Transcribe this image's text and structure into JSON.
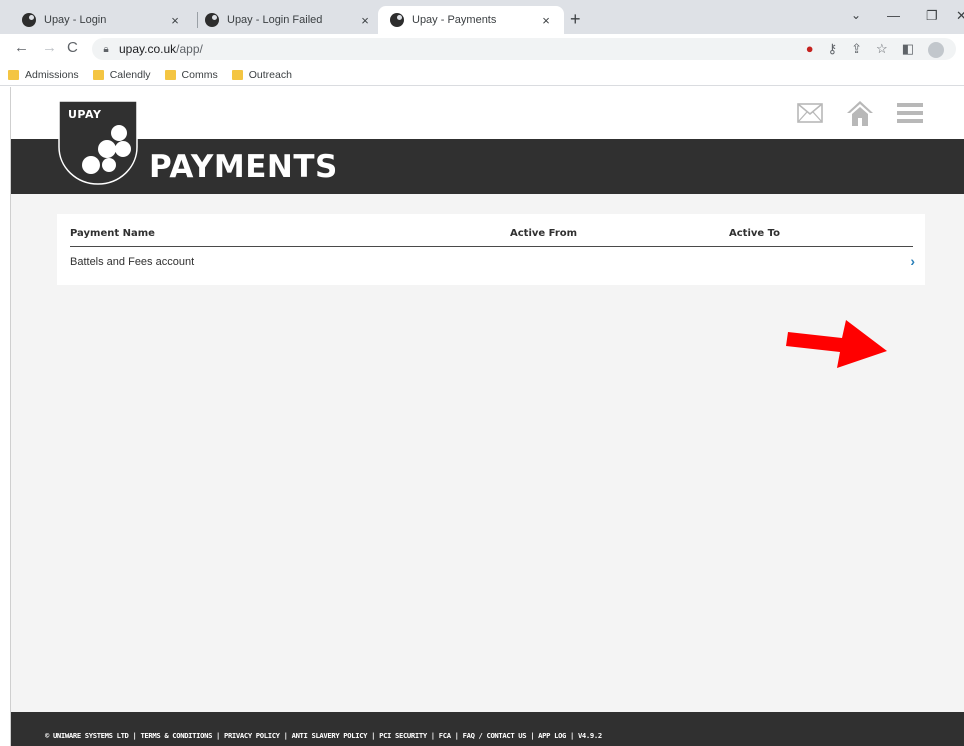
{
  "browser": {
    "tabs": [
      {
        "title": "Upay - Login",
        "active": false
      },
      {
        "title": "Upay - Login Failed",
        "active": false
      },
      {
        "title": "Upay - Payments",
        "active": true
      }
    ],
    "new_tab_icon": "+",
    "close_icon": "×",
    "window_controls": {
      "minimize": "—",
      "restore": "❐",
      "close": "✕"
    },
    "tab_list_icon": "⌄",
    "url_host": "upay.co.uk",
    "url_path": "/app/",
    "bookmarks": [
      "Admissions",
      "Calendly",
      "Comms",
      "Outreach"
    ]
  },
  "site": {
    "logo_text": "UPAY",
    "page_title": "PAYMENTS",
    "table": {
      "columns": [
        "Payment Name",
        "Active From",
        "Active To"
      ],
      "rows": [
        {
          "name": "Battels and Fees account",
          "active_from": "",
          "active_to": ""
        }
      ]
    },
    "chevron": "›",
    "footer": "© UNIWARE SYSTEMS LTD | TERMS & CONDITIONS | PRIVACY POLICY | ANTI SLAVERY POLICY | PCI SECURITY | FCA | FAQ / CONTACT US | APP LOG | V4.9.2"
  },
  "icons": [
    "mail-icon",
    "home-icon",
    "hamburger-menu-icon",
    "red-arrow-annotation"
  ],
  "colors": {
    "banner": "#303030",
    "accent": "#2a7fb8",
    "arrow": "#ff0000",
    "page_bg": "#f4f4f4"
  }
}
